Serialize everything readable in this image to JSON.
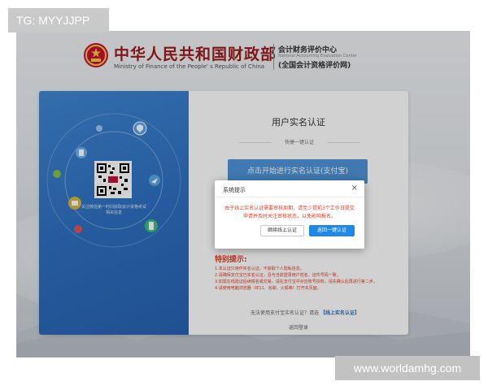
{
  "tag": {
    "label": "TG: MYYJJPP"
  },
  "watermark": {
    "text": "www.worldamhg.com"
  },
  "header": {
    "ministry_cn": "中华人民共和国财政部",
    "ministry_en": "Ministry of Finance of the People' s Republic of China",
    "center_cn": "会计财务评价中心",
    "center_en": "National Accounting Evaluation Center",
    "center_sub": "(全国会计资格评价网)"
  },
  "card": {
    "title": "用户实名认证",
    "quick_label": "快捷一键认证",
    "alipay_button": "点击开始进行实名认证(支付宝)",
    "qr_caption": "关注微信第一时间获取会计资格考试相关信息",
    "notice": {
      "title": "特别提示:",
      "items": [
        "1.本认证只用作实名认证，不获取个人隐私信息。",
        "2.请确保支付宝已实名认证，且与当前登录用户姓名、证件号码一致。",
        "3.如需在线验证后续报名或交易，请在支付宝中对应账号授权，请先确认后再进行第二步。",
        "4.请使用电脑浏览器（IE11、谷歌、火狐等）打开本页面。"
      ]
    },
    "no_alipay_text": "无法使用支付宝实名认证？请选",
    "no_alipay_link": "【线上实名认证】",
    "back_login": "返回登录"
  },
  "dialog": {
    "title": "系统提示",
    "close": "×",
    "message": "由于线上实名认证需要审核周期，请至少提前3个工作日提交申请并及时关注审核状态，以免影响报名。",
    "button_line": "继续线上认证",
    "button_back": "返回一键认证"
  },
  "colors": {
    "accent_blue": "#2d6fc0",
    "button_blue": "#1e87e8",
    "warning_red": "#e23b22",
    "ministry_red": "#9b1b1b"
  }
}
